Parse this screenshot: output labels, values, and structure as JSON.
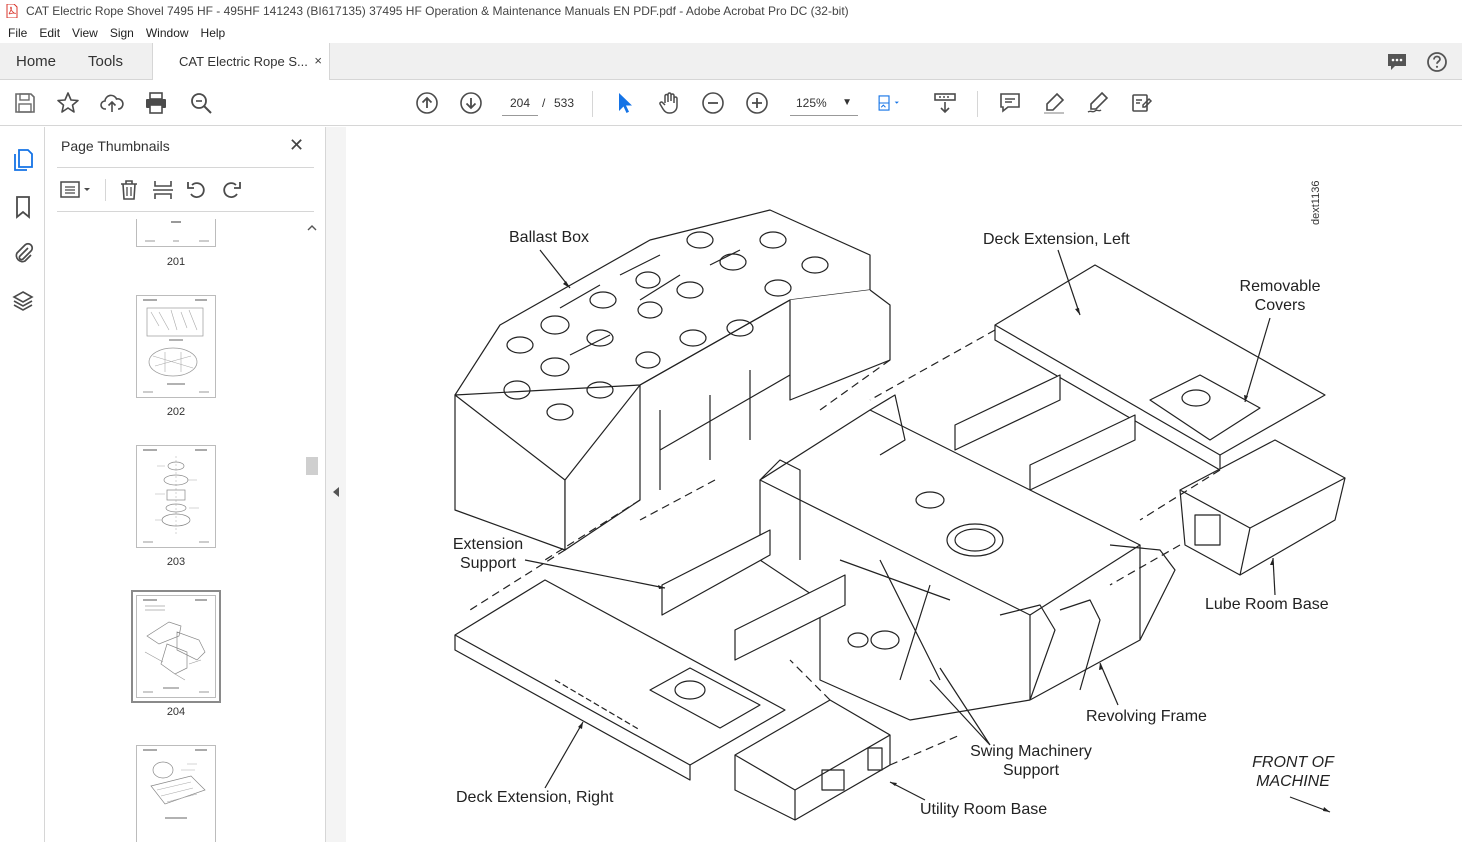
{
  "window": {
    "title": "CAT Electric Rope Shovel 7495 HF - 495HF 141243 (BI617135) 37495 HF Operation & Maintenance Manuals EN PDF.pdf - Adobe Acrobat Pro DC (32-bit)"
  },
  "menu": {
    "items": [
      "File",
      "Edit",
      "View",
      "Sign",
      "Window",
      "Help"
    ]
  },
  "tabs": {
    "home": "Home",
    "tools": "Tools",
    "doc": "CAT Electric Rope S...",
    "close": "×"
  },
  "toolbar": {
    "page_current": "204",
    "page_sep": "/",
    "page_total": "533",
    "zoom": "125%"
  },
  "panel": {
    "title": "Page Thumbnails",
    "close": "✕",
    "thumbnails": [
      {
        "num": "201"
      },
      {
        "num": "202"
      },
      {
        "num": "203"
      },
      {
        "num": "204"
      },
      {
        "num": ""
      }
    ]
  },
  "document": {
    "labels": {
      "ballast_box": "Ballast Box",
      "deck_ext_left": "Deck Extension, Left",
      "removable_covers_1": "Removable",
      "removable_covers_2": "Covers",
      "extension_support_1": "Extension",
      "extension_support_2": "Support",
      "lube_room_base": "Lube Room Base",
      "revolving_frame": "Revolving Frame",
      "swing_machinery_1": "Swing Machinery",
      "swing_machinery_2": "Support",
      "utility_room_base": "Utility Room Base",
      "deck_ext_right": "Deck Extension, Right",
      "front_1": "FRONT OF",
      "front_2": "MACHINE",
      "figure_id": "dext1136"
    }
  },
  "colors": {
    "accent": "#1473e6",
    "icon": "#4b4b4b"
  }
}
